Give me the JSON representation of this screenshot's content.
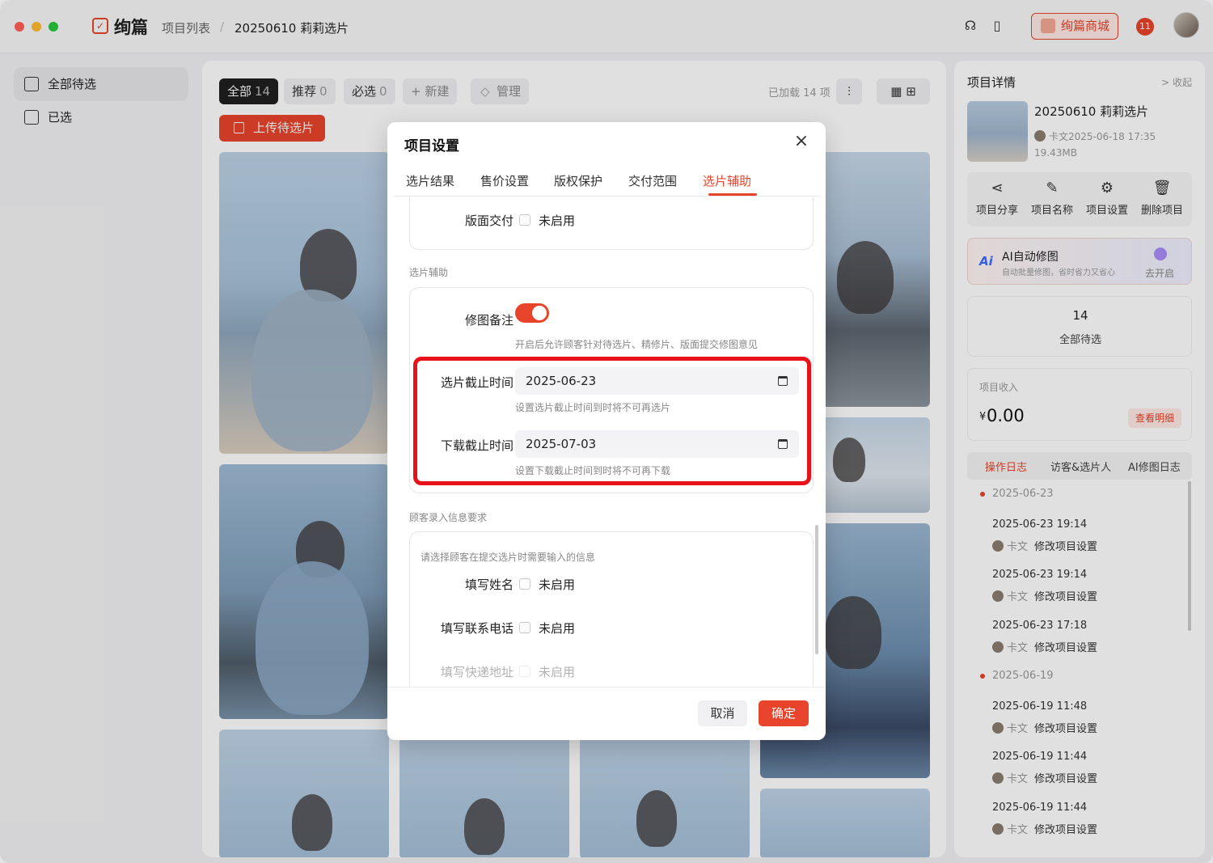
{
  "app": {
    "brand": "绚篇",
    "crumb_root": "项目列表",
    "crumb_sep": "/",
    "crumb_current": "20250610 莉莉选片",
    "shop_label": "绚篇商城",
    "notif_label": "11"
  },
  "sidebar": {
    "items": [
      {
        "label": "全部待选"
      },
      {
        "label": "已选"
      }
    ]
  },
  "toolbar": {
    "filters": [
      {
        "label": "全部",
        "count": "14"
      },
      {
        "label": "推荐",
        "count": "0"
      },
      {
        "label": "必选",
        "count": "0"
      }
    ],
    "new_label": "+ 新建",
    "manage_label": "管理",
    "loaded_text": "已加载 14 项",
    "upload_label": "上传待选片"
  },
  "detail": {
    "title": "项目详情",
    "fold": "> 收起",
    "project_name": "20250610 莉莉选片",
    "meta_line": "卡文2025-06-18 17:35",
    "size": "19.43MB",
    "actions": [
      {
        "icon": "share-icon",
        "label": "项目分享",
        "glyph": "⋖"
      },
      {
        "icon": "edit-icon",
        "label": "项目名称",
        "glyph": "✎"
      },
      {
        "icon": "gear-icon",
        "label": "项目设置",
        "glyph": "⚙"
      },
      {
        "icon": "trash-icon",
        "label": "删除项目",
        "glyph": "🗑"
      }
    ],
    "ai": {
      "title": "AI自动修图",
      "sub": "自动批量修图，省时省力又省心",
      "badge": "Ai",
      "action": "去开启"
    },
    "pending": {
      "count": "14",
      "label": "全部待选"
    },
    "income": {
      "label": "项目收入",
      "currency": "¥",
      "amount": "0.00",
      "detail_btn": "查看明细"
    },
    "log_tabs": [
      "操作日志",
      "访客&选片人",
      "AI修图日志"
    ],
    "logs": [
      {
        "date": "2025-06-23",
        "entries": [
          {
            "time": "2025-06-23 19:14",
            "who": "卡文",
            "action": "修改项目设置"
          },
          {
            "time": "2025-06-23 19:14",
            "who": "卡文",
            "action": "修改项目设置"
          },
          {
            "time": "2025-06-23 17:18",
            "who": "卡文",
            "action": "修改项目设置"
          }
        ]
      },
      {
        "date": "2025-06-19",
        "entries": [
          {
            "time": "2025-06-19 11:48",
            "who": "卡文",
            "action": "修改项目设置"
          },
          {
            "time": "2025-06-19 11:44",
            "who": "卡文",
            "action": "修改项目设置"
          },
          {
            "time": "2025-06-19 11:44",
            "who": "卡文",
            "action": "修改项目设置"
          }
        ]
      }
    ]
  },
  "modal": {
    "title": "项目设置",
    "close": "×",
    "tabs": [
      {
        "label": "选片结果"
      },
      {
        "label": "售价设置"
      },
      {
        "label": "版权保护"
      },
      {
        "label": "交付范围"
      },
      {
        "label": "选片辅助",
        "active": true
      }
    ],
    "layout_delivery": {
      "label": "版面交付",
      "value": "未启用"
    },
    "assist_section": "选片辅助",
    "retouch_note": {
      "label": "修图备注",
      "enabled": true,
      "hint": "开启后允许顾客针对待选片、精修片、版面提交修图意见"
    },
    "select_deadline": {
      "label": "选片截止时间",
      "value": "2025-06-23",
      "hint": "设置选片截止时间到时将不可再选片"
    },
    "download_deadline": {
      "label": "下载截止时间",
      "value": "2025-07-03",
      "hint": "设置下载截止时间到时将不可再下载"
    },
    "customer_section": "顾客录入信息要求",
    "customer_hint": "请选择顾客在提交选片时需要输入的信息",
    "fields": [
      {
        "label": "填写姓名",
        "value": "未启用"
      },
      {
        "label": "填写联系电话",
        "value": "未启用"
      },
      {
        "label": "填写快递地址",
        "value": "未启用"
      }
    ],
    "cancel": "取消",
    "ok": "确定"
  }
}
